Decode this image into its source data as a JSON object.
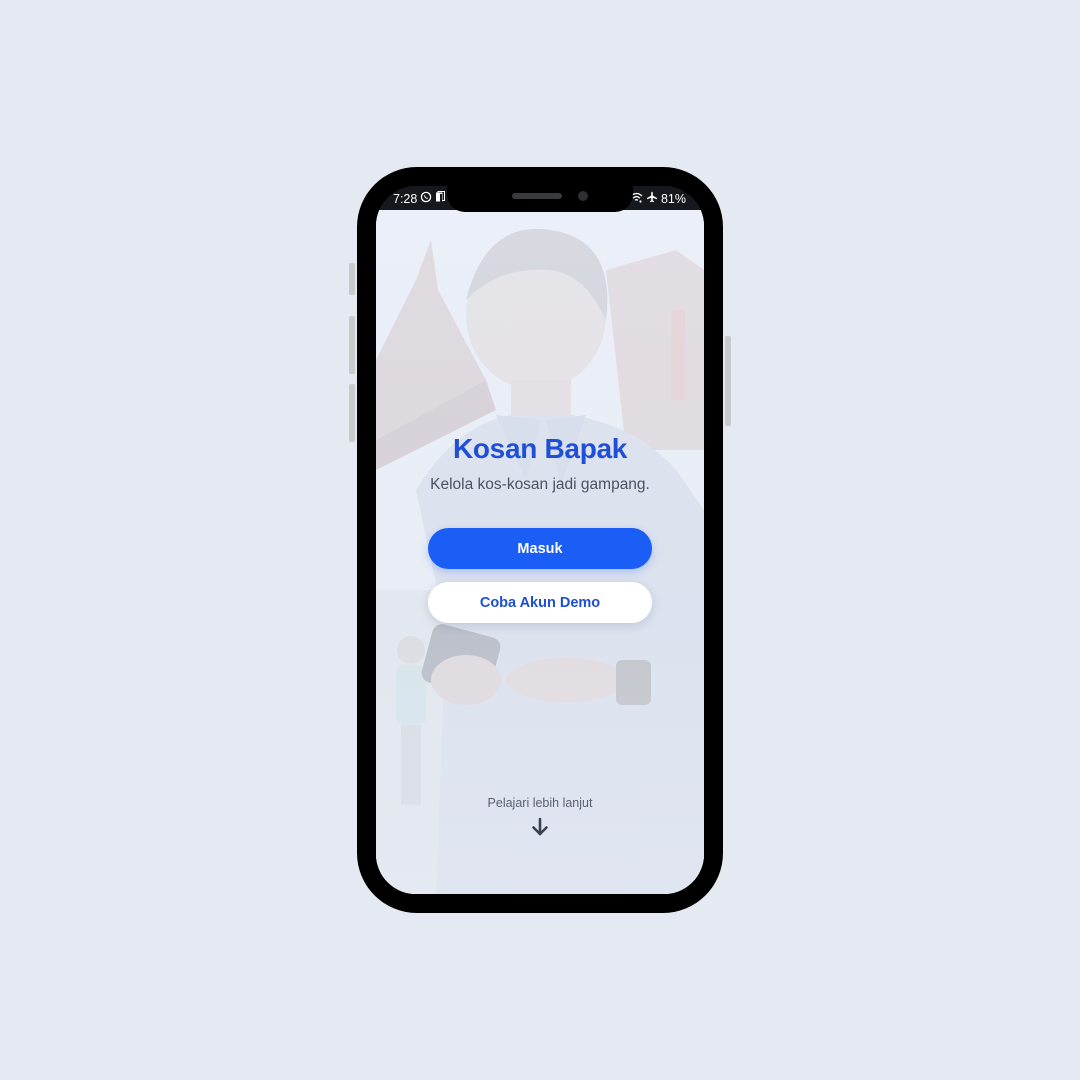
{
  "status_bar": {
    "time": "7:28",
    "left_icons": [
      "whatsapp-icon",
      "notification-icon"
    ],
    "right_icons": [
      "wifi-icon",
      "airplane-icon"
    ],
    "battery": "81%"
  },
  "app": {
    "title": "Kosan Bapak",
    "tagline": "Kelola kos-kosan jadi gampang.",
    "login_button": "Masuk",
    "demo_button": "Coba Akun Demo",
    "learn_more": "Pelajari lebih lanjut",
    "learn_more_icon": "arrow-down-icon"
  },
  "colors": {
    "title": "#1f4fd6",
    "primary": "#1a5ef5",
    "background": "#e4e9f2"
  }
}
